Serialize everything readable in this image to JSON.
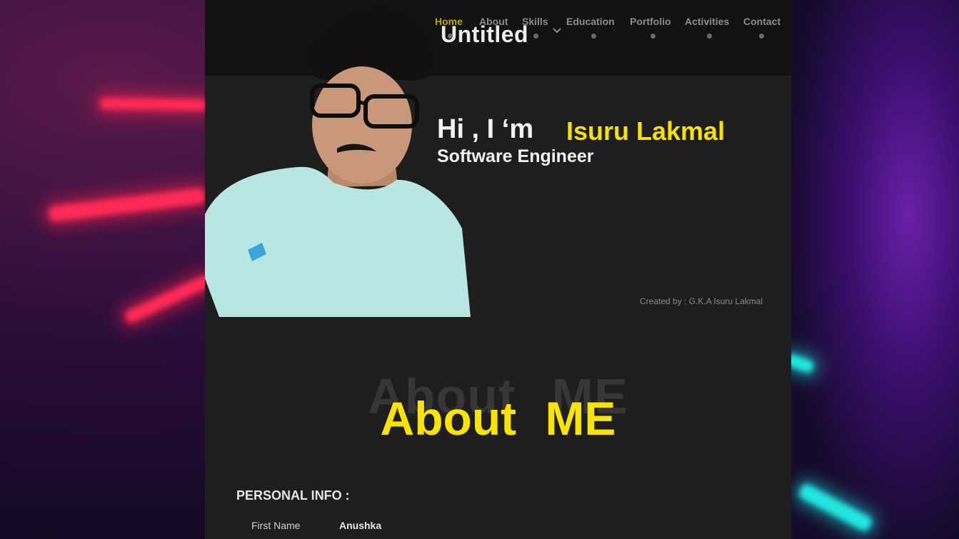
{
  "brand": "Untitled",
  "nav": {
    "items": [
      {
        "label": "Home",
        "active": true
      },
      {
        "label": "About",
        "active": false
      },
      {
        "label": "Skills",
        "active": false
      },
      {
        "label": "Education",
        "active": false
      },
      {
        "label": "Portfolio",
        "active": false
      },
      {
        "label": "Activities",
        "active": false
      },
      {
        "label": "Contact",
        "active": false
      }
    ],
    "active_color": "#b9a50c",
    "dropdown_icon": "chevron-down-icon"
  },
  "hero": {
    "greeting": "Hi , I ‘m",
    "name": "Isuru Lakmal",
    "role": "Software Engineer",
    "credit": "Created by : G.K.A Isuru Lakmal",
    "accent_color": "#f5e200"
  },
  "about": {
    "shadow_text": "About ME",
    "title": "About ME"
  },
  "personal_info": {
    "heading": "PERSONAL INFO :",
    "fields": [
      {
        "label": "First Name",
        "value": "Anushka"
      }
    ]
  }
}
